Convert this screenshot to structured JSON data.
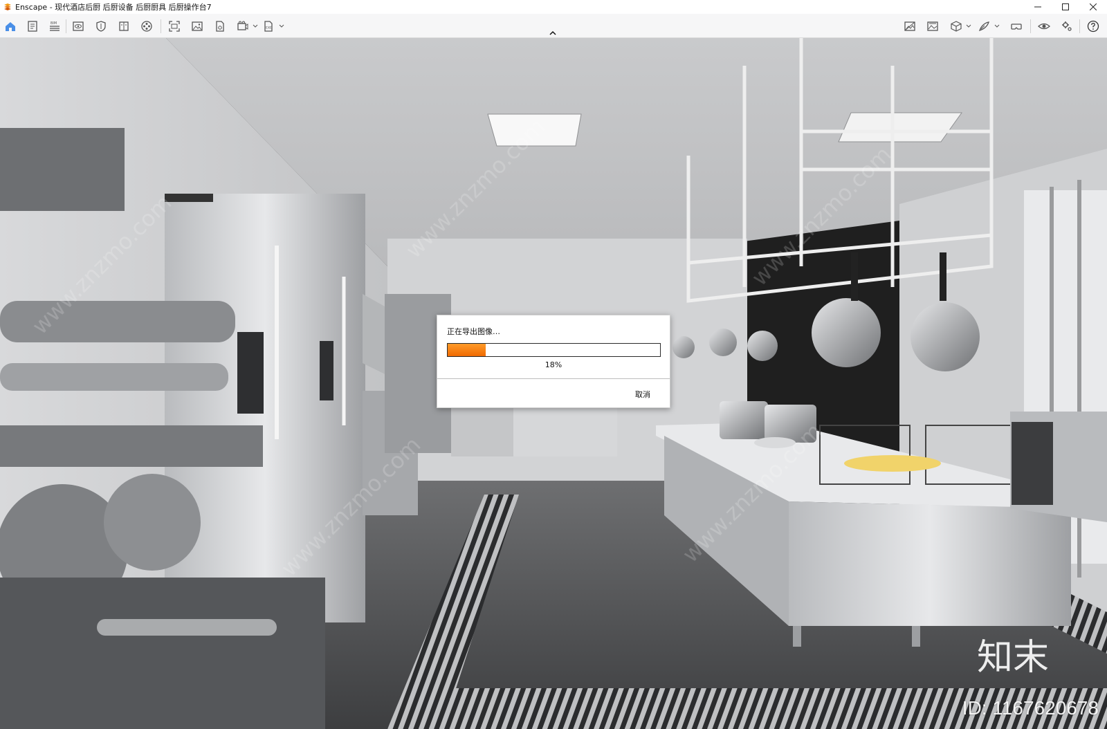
{
  "window": {
    "app_name": "Enscape",
    "title": "Enscape - 现代酒店后厨 后厨设备 后厨厨具 后厨操作台7"
  },
  "toolbar": {
    "left_icons": [
      "home-icon",
      "document-icon",
      "bim-list-icon",
      "eye-box-icon",
      "shield-icon",
      "book-icon",
      "film-reel-icon",
      "screenshot-icon",
      "image-icon",
      "file-edit-icon",
      "video-record-icon",
      "exe-export-icon"
    ],
    "right_icons": [
      "image-compare-icon",
      "photo-settings-icon",
      "cube-icon",
      "brush-icon",
      "vr-headset-icon",
      "eye-icon",
      "settings-gear-icon",
      "help-icon"
    ],
    "bim_label": "BIM",
    "exe_label": "EXE"
  },
  "dialog": {
    "title": "正在导出图像…",
    "progress_percent": 18,
    "progress_text": "18%",
    "cancel_label": "取消",
    "accent_color": "#f07a10"
  },
  "watermark": {
    "brand": "知末",
    "id_text": "ID: 1167620678"
  }
}
